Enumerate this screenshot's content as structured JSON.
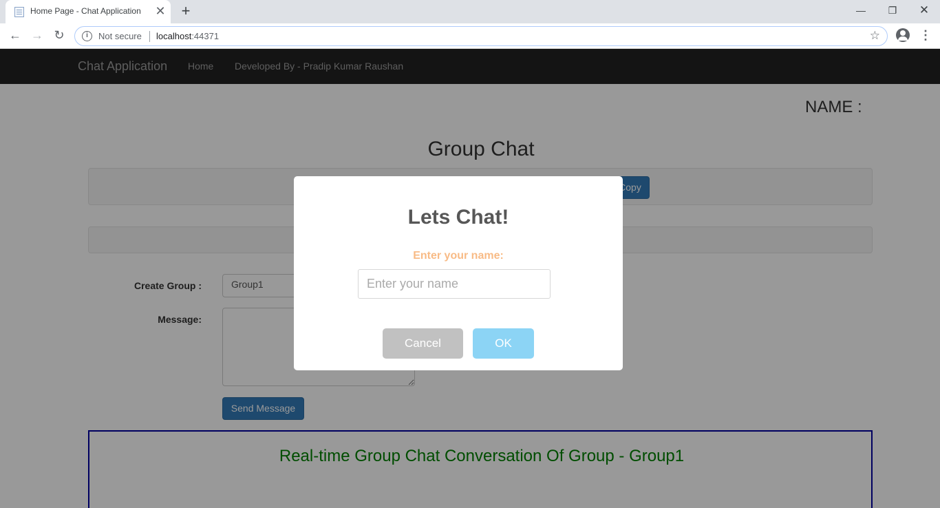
{
  "browser": {
    "tab_title": "Home Page - Chat Application",
    "tab_close": "✕",
    "new_tab": "+",
    "security_label": "Not secure",
    "url_host": "localhost",
    "url_port": ":44371"
  },
  "navbar": {
    "brand": "Chat Application",
    "links": [
      "Home",
      "Developed By - Pradip Kumar Raushan"
    ]
  },
  "page": {
    "name_label": "NAME :",
    "title": "Group Chat",
    "copy_button": "Copy",
    "create_group_label": "Create Group :",
    "group_value": "Group1",
    "message_label": "Message:",
    "send_button": "Send Message",
    "conversation_title": "Real-time Group Chat Conversation Of Group - Group1"
  },
  "modal": {
    "title": "Lets Chat!",
    "label": "Enter your name:",
    "input_placeholder": "Enter your name",
    "cancel_button": "Cancel",
    "ok_button": "OK"
  },
  "colors": {
    "navbar_bg": "#222222",
    "primary_button": "#337ab7",
    "conversation_border": "#0000a0",
    "conversation_title": "#008000",
    "modal_label": "#f8bb86",
    "ok_button": "#8cd4f5",
    "cancel_button": "#c1c1c1"
  }
}
